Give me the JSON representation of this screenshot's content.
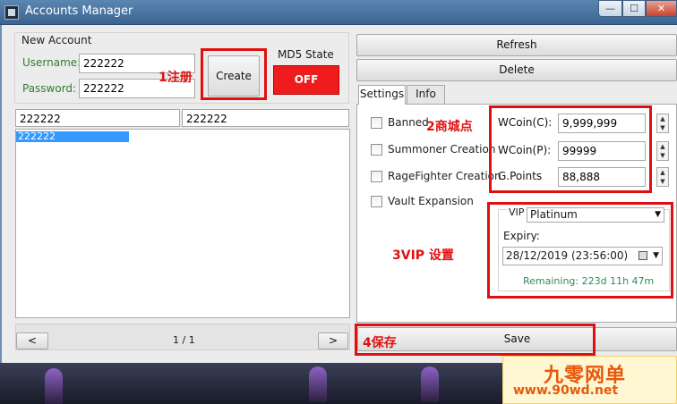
{
  "window": {
    "title": "Accounts Manager",
    "minimize_glyph": "—",
    "maximize_glyph": "☐",
    "close_glyph": "✕"
  },
  "new_account": {
    "legend": "New Account",
    "username_label": "Username:",
    "username_value": "222222",
    "password_label": "Password:",
    "password_value": "222222",
    "create_label": "Create",
    "md5_state_label": "MD5 State",
    "md5_toggle_label": "OFF"
  },
  "account_list": {
    "search_left": "222222",
    "search_right": "222222",
    "rows": [
      "222222"
    ],
    "prev_label": "<",
    "next_label": ">",
    "page_indicator": "1 / 1"
  },
  "actions": {
    "refresh_label": "Refresh",
    "delete_label": "Delete",
    "save_label": "Save"
  },
  "tabs": [
    {
      "label": "Settings",
      "active": true
    },
    {
      "label": "Info",
      "active": false
    }
  ],
  "settings": {
    "checkboxes": [
      {
        "label": "Banned",
        "checked": false
      },
      {
        "label": "Summoner Creation",
        "checked": false
      },
      {
        "label": "RageFighter Creation",
        "checked": false
      },
      {
        "label": "Vault Expansion",
        "checked": false
      }
    ],
    "wcoin_c_label": "WCoin(C):",
    "wcoin_c_value": "9,999,999",
    "wcoin_p_label": "WCoin(P):",
    "wcoin_p_value": "99999",
    "gpoints_label": "G.Points",
    "gpoints_value": "88,888",
    "vip_label": "VIP",
    "vip_selected": "Platinum",
    "expiry_label": "Expiry:",
    "expiry_value": "28/12/2019 (23:56:00)",
    "remaining_text": "Remaining: 223d 11h 47m"
  },
  "annotations": {
    "step1": "1注册",
    "step2": "2商城点",
    "step3": "3VIP 设置",
    "step4": "4保存",
    "color": "#e01010"
  },
  "watermark": {
    "title": "九零网单",
    "url": "www.90wd.net"
  },
  "colors": {
    "md5_off": "#ee1c1c",
    "selection": "#3399ff",
    "remaining": "#2e8b57",
    "field_label_green": "#2e7d32"
  }
}
